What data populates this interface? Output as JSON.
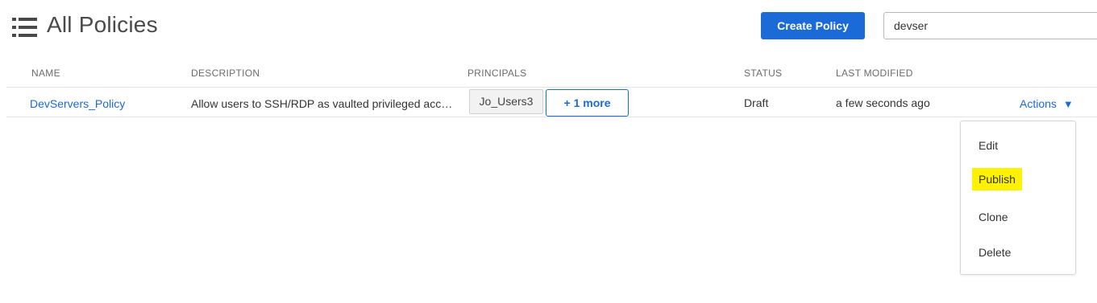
{
  "header": {
    "title": "All Policies",
    "create_label": "Create Policy",
    "search_value": "devser"
  },
  "table": {
    "columns": [
      "NAME",
      "DESCRIPTION",
      "PRINCIPALS",
      "STATUS",
      "LAST MODIFIED"
    ],
    "rows": [
      {
        "name": "DevServers_Policy",
        "description": "Allow users to SSH/RDP as vaulted privileged accounts",
        "principal": "Jo_Users3",
        "more": "+ 1 more",
        "status": "Draft",
        "modified": "a few seconds ago",
        "actions": "Actions"
      }
    ]
  },
  "menu": {
    "items": [
      "Edit",
      "Publish",
      "Clone",
      "Delete"
    ],
    "highlighted": "Publish"
  },
  "colors": {
    "accent": "#1a6ad8",
    "highlight": "#fff200"
  },
  "icons": {
    "title": "list-icon",
    "actions": "caret-down-icon"
  }
}
